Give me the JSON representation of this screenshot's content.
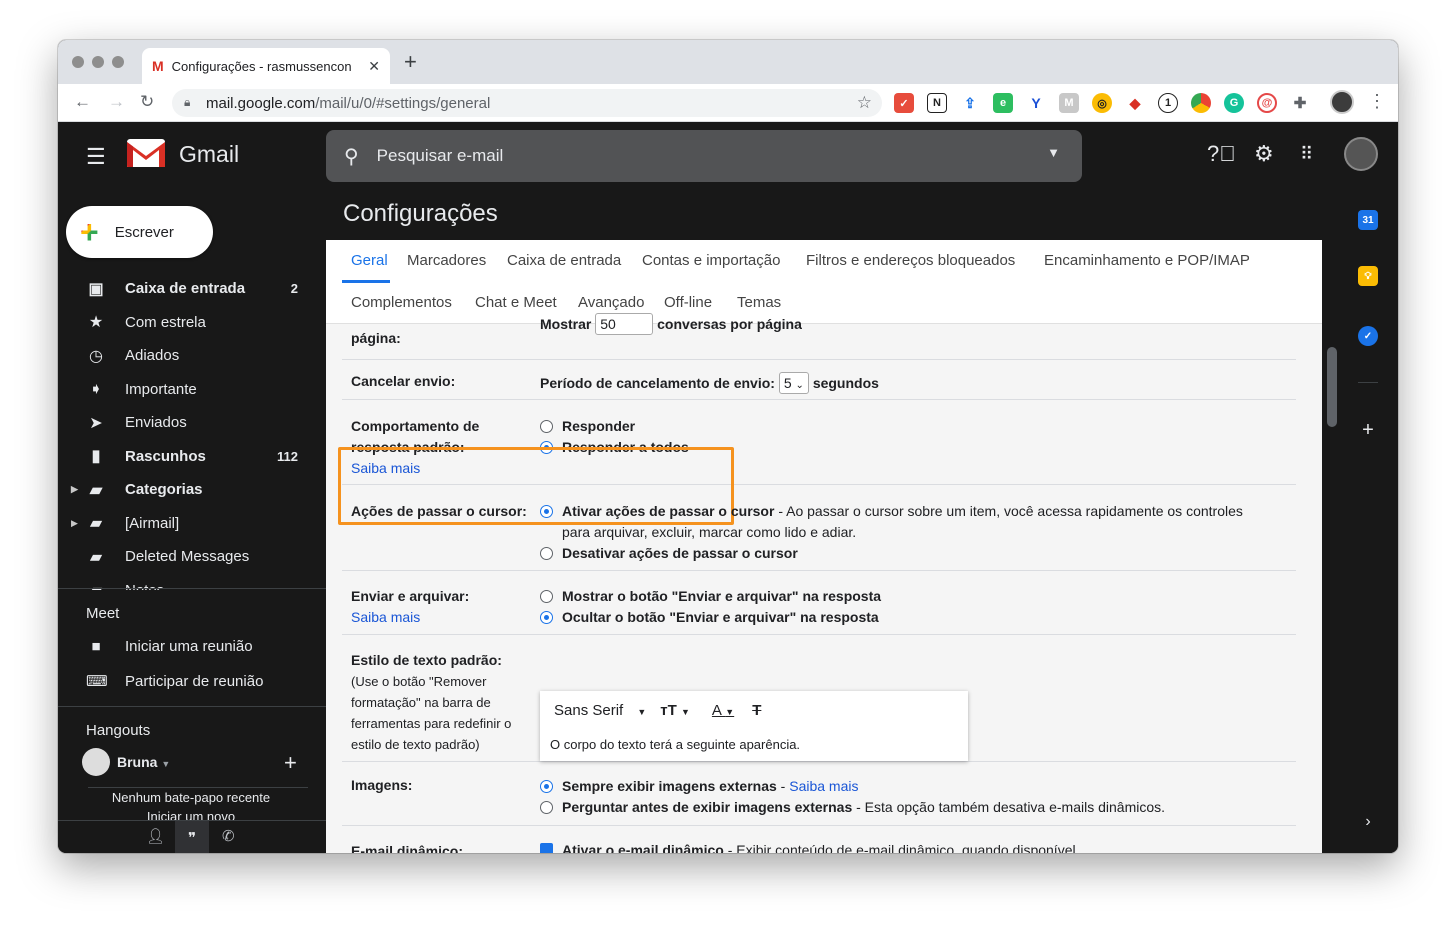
{
  "browser": {
    "tab_title": "Configurações - rasmussencon",
    "tab_favicon": "M",
    "url_host": "mail.google.com",
    "url_path": "/mail/u/0/#settings/general",
    "extensions": [
      "ext-red",
      "notion",
      "share",
      "evernote",
      "ext-v",
      "ext-m",
      "ext-y",
      "ext-arrow",
      "ext-one",
      "ext-chrome",
      "grammarly",
      "ext-lastpass",
      "puzzle"
    ]
  },
  "gmail": {
    "brand": "Gmail",
    "search_placeholder": "Pesquisar e-mail",
    "compose_label": "Escrever",
    "page_title": "Configurações"
  },
  "sidebar": {
    "items": [
      {
        "label": "Caixa de entrada",
        "count": "2",
        "icon": "inbox-icon",
        "bold": true
      },
      {
        "label": "Com estrela",
        "count": "",
        "icon": "star-icon",
        "bold": false
      },
      {
        "label": "Adiados",
        "count": "",
        "icon": "clock-icon",
        "bold": false
      },
      {
        "label": "Importante",
        "count": "",
        "icon": "label-important-icon",
        "bold": false
      },
      {
        "label": "Enviados",
        "count": "",
        "icon": "send-icon",
        "bold": false
      },
      {
        "label": "Rascunhos",
        "count": "112",
        "icon": "draft-icon",
        "bold": true
      },
      {
        "label": "Categorias",
        "count": "",
        "icon": "label-icon",
        "bold": true
      },
      {
        "label": "[Airmail]",
        "count": "",
        "icon": "label-icon",
        "bold": false
      },
      {
        "label": "Deleted Messages",
        "count": "",
        "icon": "label-icon",
        "bold": false
      },
      {
        "label": "Notes",
        "count": "",
        "icon": "label-icon",
        "bold": false
      }
    ],
    "meet_title": "Meet",
    "meet_new": "Iniciar uma reunião",
    "meet_join": "Participar de reunião",
    "hangouts_title": "Hangouts",
    "hangouts_user": "Bruna",
    "hangouts_empty": "Nenhum bate-papo recente",
    "hangouts_start": "Iniciar um novo"
  },
  "settings_tabs": {
    "row1": [
      "Geral",
      "Marcadores",
      "Caixa de entrada",
      "Contas e importação",
      "Filtros e endereços bloqueados",
      "Encaminhamento e POP/IMAP"
    ],
    "row2": [
      "Complementos",
      "Chat e Meet",
      "Avançado",
      "Off-line",
      "Temas"
    ]
  },
  "settings": {
    "page_size_label": "página:",
    "page_size_show": "Mostrar",
    "page_size_value": "50",
    "page_size_suffix": "conversas por página",
    "undo_label": "Cancelar envio:",
    "undo_prefix": "Período de cancelamento de envio:",
    "undo_value": "5",
    "undo_suffix": "segundos",
    "reply_label_1": "Comportamento de",
    "reply_label_2": "resposta padrão:",
    "learn_more": "Saiba mais",
    "reply_opt_1": "Responder",
    "reply_opt_2": "Responder a todos",
    "hover_label": "Ações de passar o cursor:",
    "hover_on": "Ativar ações de passar o cursor",
    "hover_on_desc_1": " - Ao passar o cursor sobre um item, você acessa rapidamente os controles",
    "hover_on_desc_2": "para arquivar, excluir, marcar como lido e adiar.",
    "hover_off": "Desativar ações de passar o cursor",
    "send_archive_label": "Enviar e arquivar:",
    "send_archive_show": "Mostrar o botão \"Enviar e arquivar\" na resposta",
    "send_archive_hide": "Ocultar o botão \"Enviar e arquivar\" na resposta",
    "text_style_label": "Estilo de texto padrão:",
    "text_style_note_1": "(Use o botão \"Remover",
    "text_style_note_2": "formatação\" na barra de",
    "text_style_note_3": "ferramentas para redefinir o",
    "text_style_note_4": "estilo de texto padrão)",
    "font_name": "Sans Serif",
    "preview_text": "O corpo do texto terá a seguinte aparência.",
    "images_label": "Imagens:",
    "images_always": "Sempre exibir imagens externas",
    "images_ask": "Perguntar antes de exibir imagens externas",
    "images_ask_desc": " - Esta opção também desativa e-mails dinâmicos.",
    "dynamic_label": "E-mail dinâmico:",
    "dynamic_opt": "Ativar o e-mail dinâmico",
    "dynamic_desc": " - Exibir conteúdo de e-mail dinâmico, quando disponível."
  },
  "colors": {
    "accent": "#1a73e8",
    "highlight": "#f5921e",
    "dark_bg": "#181818"
  }
}
